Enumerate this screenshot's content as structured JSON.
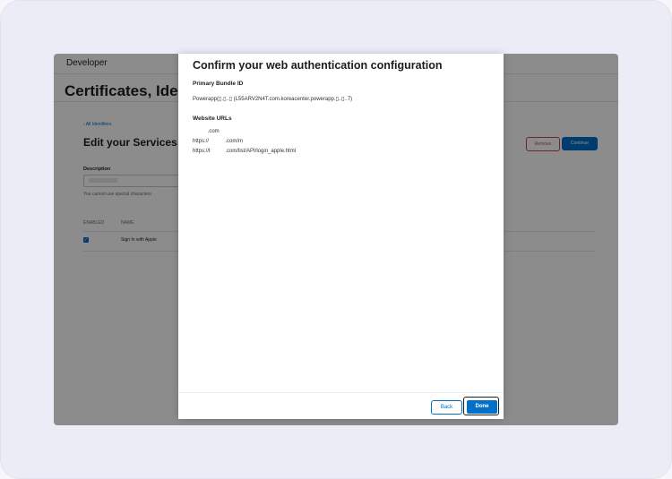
{
  "header": {
    "brand": "Developer",
    "brand_icon": "apple-icon"
  },
  "page": {
    "title": "Certificates, Ide"
  },
  "identifier": {
    "back_link": "‹ All Identifiers",
    "section_title": "Edit your Services I",
    "remove_label": "Remove",
    "continue_label": "Continue",
    "description_label": "Description",
    "help_text": "You cannot use special characters",
    "columns": {
      "enabled": "ENABLED",
      "name": "NAME"
    },
    "capability": {
      "name": "Sign In with Apple",
      "enabled": true
    }
  },
  "modal": {
    "title": "Confirm your web authentication configuration",
    "bundle_label": "Primary Bundle ID",
    "bundle_value": "Powerapp(▯.▯..▯ (L55ARV2N4T.com.koreacenter.powerapp.▯..▯..7)",
    "urls_label": "Website URLs",
    "urls": [
      "          .com",
      "https://           .com/m",
      "https://t          .com/list/API/login_apple.html"
    ],
    "back_label": "Back",
    "done_label": "Done"
  },
  "colors": {
    "accent": "#0070c9",
    "danger": "#d04848"
  }
}
